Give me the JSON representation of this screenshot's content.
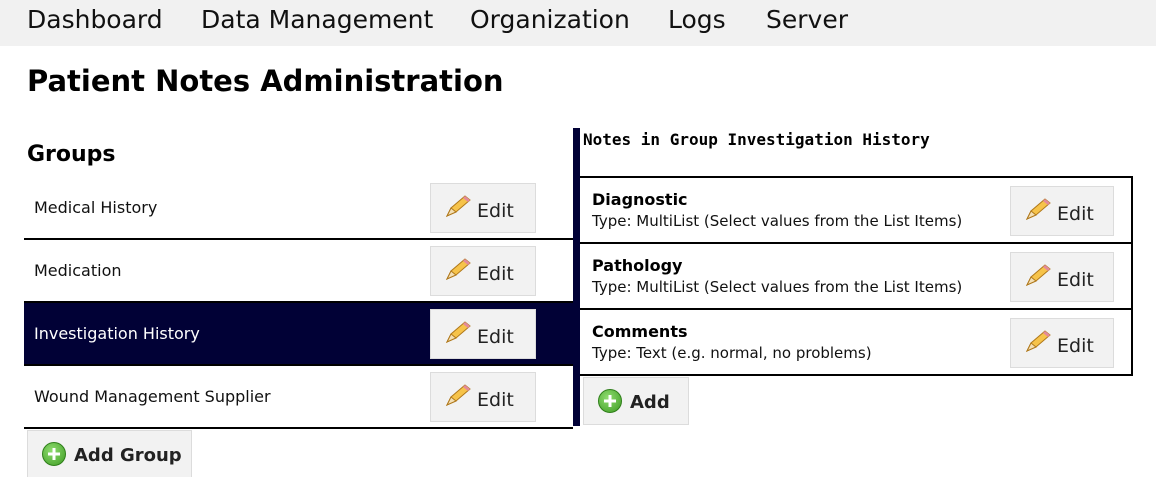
{
  "nav": {
    "items": [
      {
        "label": "Dashboard"
      },
      {
        "label": "Data Management"
      },
      {
        "label": "Organization"
      },
      {
        "label": "Logs"
      },
      {
        "label": "Server"
      }
    ]
  },
  "page": {
    "title": "Patient Notes Administration"
  },
  "groups": {
    "title": "Groups",
    "edit_label": "Edit",
    "items": [
      {
        "label": "Medical History",
        "selected": false
      },
      {
        "label": "Medication",
        "selected": false
      },
      {
        "label": "Investigation History",
        "selected": true
      },
      {
        "label": "Wound Management Supplier",
        "selected": false
      }
    ],
    "add_label": "Add Group"
  },
  "notes": {
    "header": "Notes in Group Investigation History",
    "edit_label": "Edit",
    "items": [
      {
        "title": "Diagnostic",
        "type": "Type: MultiList (Select values from the List Items)"
      },
      {
        "title": "Pathology",
        "type": "Type: MultiList (Select values from the List Items)"
      },
      {
        "title": "Comments",
        "type": "Type: Text (e.g. normal, no problems)"
      }
    ],
    "add_label": "Add"
  },
  "colors": {
    "selected_row": "#010136",
    "nav_background": "#f1f1f1",
    "button_background": "#f2f2f2"
  },
  "icons": {
    "edit": "pencil-icon",
    "add": "plus-circle-icon"
  }
}
